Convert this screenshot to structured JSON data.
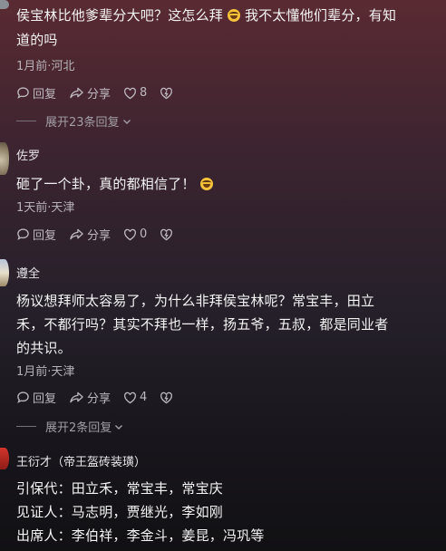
{
  "comment1": {
    "text_line1": "侯宝林比他爹辈分大吧？这怎么拜",
    "text_line1b": "我不太懂他们辈分，有知",
    "text_line2": "道的吗",
    "meta": "1月前·河北",
    "reply": "回复",
    "share": "分享",
    "likes": "8",
    "expand": "展开23条回复"
  },
  "comment2": {
    "user": "佐罗",
    "text": "砸了一个卦，真的都相信了！",
    "meta": "1天前·天津",
    "reply": "回复",
    "share": "分享",
    "likes": "0"
  },
  "comment3": {
    "user": "遵全",
    "text_line1": "杨议想拜师太容易了，为什么非拜侯宝林呢？常宝丰，田立",
    "text_line2": "禾，不都行吗？其实不拜也一样，扬五爷，五叔，都是同业者",
    "text_line3": "的共识。",
    "meta": "1月前·天津",
    "reply": "回复",
    "share": "分享",
    "likes": "4",
    "expand": "展开2条回复"
  },
  "comment4": {
    "user": "王衍才（帝王盔砖装璜）",
    "line1": "引保代：田立禾，常宝丰，常宝庆",
    "line2": "见证人：马志明，贾继光，李如刚",
    "line3": "出席人：李伯祥，李金斗，姜昆，冯巩等"
  },
  "icons": [
    "chat-bubble-icon",
    "share-arrow-icon",
    "heart-icon",
    "dislike-heart-icon",
    "chevron-down-icon",
    "laugh-emoji-icon"
  ]
}
